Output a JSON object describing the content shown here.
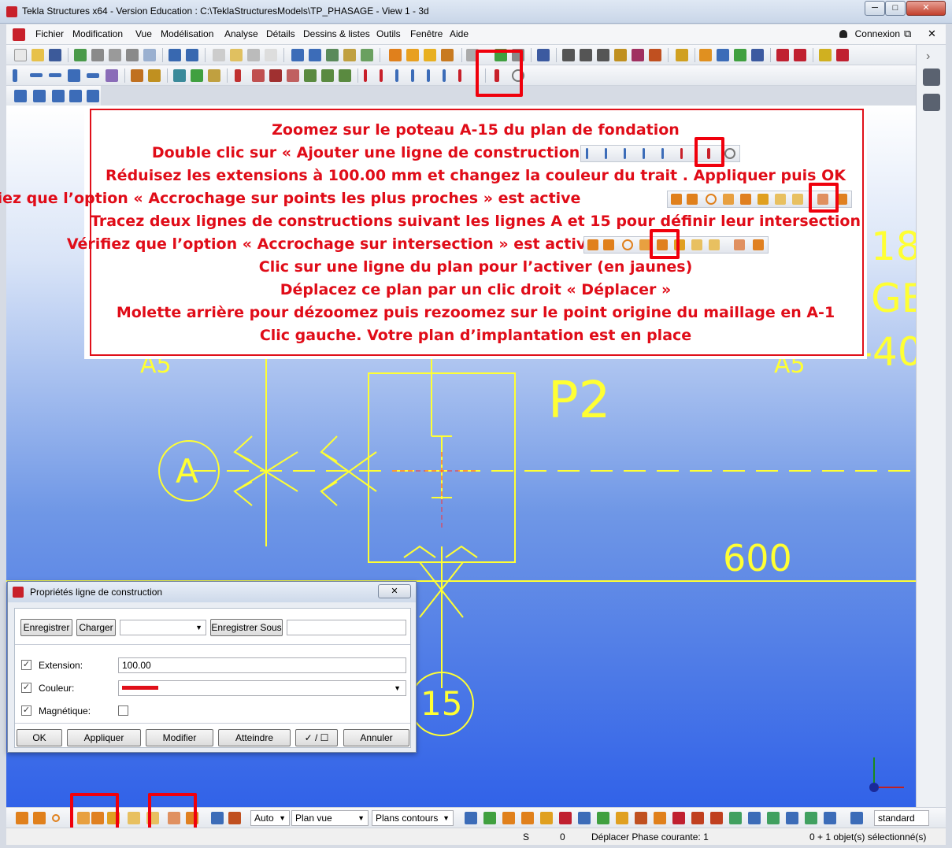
{
  "window": {
    "title": "Tekla Structures x64 - Version Education : C:\\TeklaStructuresModels\\TP_PHASAGE - View 1 - 3d",
    "minimize": "─",
    "maximize": "□",
    "close": "✕"
  },
  "menu": {
    "items": [
      "Fichier",
      "Modification",
      "Vue",
      "Modélisation",
      "Analyse",
      "Détails",
      "Dessins & listes",
      "Outils",
      "Fenêtre",
      "Aide"
    ],
    "connexion": "Connexion",
    "restore": "⧉",
    "close": "✕"
  },
  "instructions": {
    "lines": [
      "Zoomez  sur le poteau A-15 du plan de fondation",
      "Double clic  sur « Ajouter une ligne de construction »",
      "Réduisez les extensions à 100.00 mm et changez la couleur du trait . Appliquer puis OK",
      "Vérifiez que l’option « Accrochage sur points les plus proches » est active",
      "Tracez deux lignes de constructions suivant les lignes A et 15 pour définir leur intersection",
      "Vérifiez que l’option « Accrochage sur intersection » est active",
      "Clic sur une ligne du plan pour l’activer (en jaunes)",
      "Déplacez ce plan par un clic droit « Déplacer »",
      "Molette arrière pour dézoomez puis rezoomez sur le point origine du maillage en A-1",
      "Clic gauche. Votre plan d’implantation est en place"
    ]
  },
  "drawing": {
    "grid_a": "A",
    "grid_15": "15",
    "column": "P2",
    "dimension": "600",
    "edge_text_1": "18",
    "edge_text_2": "GE",
    "edge_text_3": "-40",
    "edge_text_4": "A5",
    "edge_text_5": "A5"
  },
  "dialog": {
    "title": "Propriétés ligne de construction",
    "close": "✕",
    "save": "Enregistrer",
    "load": "Charger",
    "save_as": "Enregistrer Sous",
    "extension_label": "Extension:",
    "extension_value": "100.00",
    "color_label": "Couleur:",
    "color_value": "#e0101a",
    "magnetic_label": "Magnétique:",
    "ok": "OK",
    "apply": "Appliquer",
    "modify": "Modifier",
    "get": "Atteindre",
    "toggle": "✓ / ☐",
    "cancel": "Annuler"
  },
  "bottom_toolbar": {
    "auto": "Auto",
    "plan_vue": "Plan vue",
    "plans_contours": "Plans contours",
    "standard": "standard"
  },
  "status": {
    "s": "S",
    "zero": "0",
    "message": "Déplacer Phase courante: 1",
    "selection": "0 + 1 objet(s) sélectionné(s)"
  },
  "colors": {
    "accent_red": "#e00c18",
    "drawing_yellow": "#ffff33",
    "viewport_blue": "#3162e8"
  }
}
